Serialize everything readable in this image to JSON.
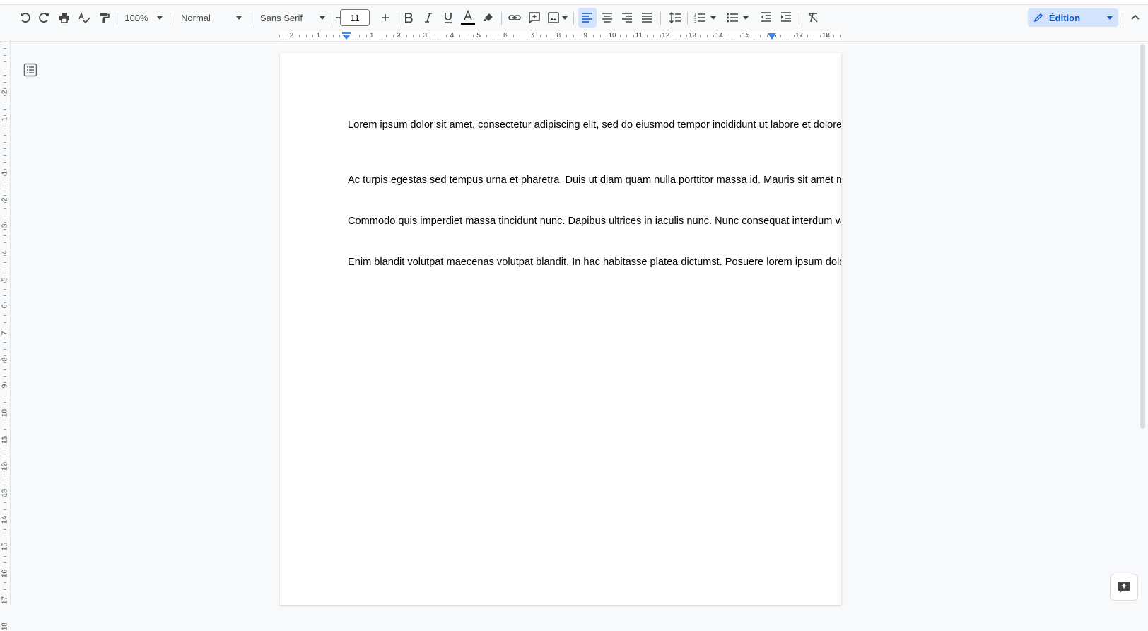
{
  "toolbar": {
    "zoom": "100%",
    "style": "Normal",
    "font": "Sans Serif",
    "font_size": "11",
    "edit_mode": "Édition"
  },
  "ruler": {
    "h_numbers": [
      "2",
      "1",
      "1",
      "2",
      "3",
      "4",
      "5",
      "6",
      "7",
      "8",
      "9",
      "10",
      "11",
      "12",
      "13",
      "14",
      "15",
      "16",
      "17",
      "18"
    ],
    "v_numbers": [
      "2",
      "1",
      "1",
      "2",
      "3",
      "4",
      "5",
      "6",
      "7",
      "8",
      "9",
      "10",
      "11",
      "12",
      "13",
      "14",
      "15",
      "16",
      "17",
      "18"
    ]
  },
  "document": {
    "paragraphs": [
      "Lorem ipsum dolor sit amet, consectetur adipiscing elit, sed do eiusmod tempor incididunt ut labore et dolore",
      "Ac turpis egestas sed tempus urna et pharetra. Duis ut diam quam nulla porttitor massa id. Mauris sit amet m",
      "Commodo quis imperdiet massa tincidunt nunc. Dapibus ultrices in iaculis nunc. Nunc consequat interdum va",
      "Enim blandit volutpat maecenas volutpat blandit. In hac habitasse platea dictumst. Posuere lorem ipsum dolo"
    ]
  },
  "colors": {
    "accent": "#0b57d0",
    "accent_bg": "#d3e3fd",
    "text_color_bar": "#000000"
  },
  "icons": [
    "undo-icon",
    "redo-icon",
    "print-icon",
    "spellcheck-icon",
    "paint-format-icon",
    "minus-icon",
    "plus-icon",
    "bold-icon",
    "italic-icon",
    "underline-icon",
    "text-color-icon",
    "highlight-icon",
    "link-icon",
    "comment-icon",
    "image-icon",
    "align-left-icon",
    "align-center-icon",
    "align-right-icon",
    "justify-icon",
    "line-spacing-icon",
    "numbered-list-icon",
    "bulleted-list-icon",
    "decrease-indent-icon",
    "increase-indent-icon",
    "clear-format-icon",
    "pencil-icon",
    "collapse-icon",
    "outline-icon",
    "assistant-icon"
  ]
}
